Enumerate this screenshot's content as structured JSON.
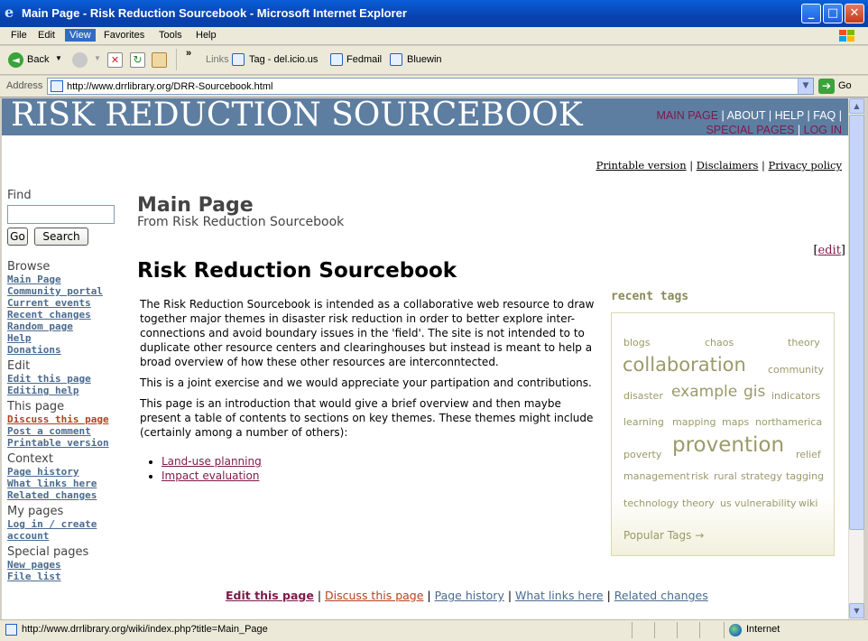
{
  "window": {
    "title": "Main Page - Risk Reduction Sourcebook - Microsoft Internet Explorer"
  },
  "menu": [
    "File",
    "Edit",
    "View",
    "Favorites",
    "Tools",
    "Help"
  ],
  "toolbar": {
    "back_label": "Back",
    "links_label": "Links",
    "chevron": "»",
    "links": [
      "Tag - del.icio.us",
      "Fedmail",
      "Bluewin"
    ]
  },
  "address": {
    "label": "Address",
    "url": "http://www.drrlibrary.org/DRR-Sourcebook.html",
    "go_label": "Go"
  },
  "page": {
    "logo": "RISK REDUCTION SOURCEBOOK",
    "topnav": [
      "MAIN PAGE",
      "ABOUT",
      "HELP",
      "FAQ",
      "SPECIAL PAGES",
      "LOG IN"
    ],
    "tools_links": [
      "Printable version",
      "Disclaimers",
      "Privacy policy"
    ],
    "sidebar": {
      "find_heading": "Find",
      "go_button": "Go",
      "search_button": "Search",
      "browse_heading": "Browse",
      "browse_links": [
        "Main Page",
        "Community portal",
        "Current events",
        "Recent changes",
        "Random page",
        "Help",
        "Donations"
      ],
      "edit_heading": "Edit",
      "edit_links": [
        "Edit this page",
        "Editing help"
      ],
      "thispage_heading": "This page",
      "thispage_links": [
        "Discuss this page",
        "Post a comment",
        "Printable version"
      ],
      "context_heading": "Context",
      "context_links": [
        "Page history",
        "What links here",
        "Related changes"
      ],
      "mypages_heading": "My pages",
      "mypages_links": [
        "Log in / create",
        "account"
      ],
      "special_heading": "Special pages",
      "special_links": [
        "New pages",
        "File list"
      ]
    },
    "title": "Main Page",
    "subtitle": "From Risk Reduction Sourcebook",
    "edit_link": "edit",
    "heading": "Risk Reduction Sourcebook",
    "paragraphs": [
      "The Risk Reduction Sourcebook is intended as a collaborative web resource to draw together major themes in disaster risk reduction in order to better explore inter-connections and avoid boundary issues in the 'field'. The site is not intended to to duplicate other resource centers and clearinghouses but instead is meant to help a broad overview of how these other resources are interconntected.",
      "This is a joint exercise and we would appreciate your partipation and contributions.",
      "This page is an introduction that would give a brief overview and then maybe present a table of contents to sections on key themes. These themes might include (certainly among a number of others):"
    ],
    "list_items": [
      "Land-use planning",
      "Impact evaluation"
    ],
    "recent_tags_heading": "recent tags",
    "tags": [
      "blogs",
      "chaos",
      "theory",
      "collaboration",
      "community",
      "disaster",
      "example",
      "gis",
      "indicators",
      "learning",
      "mapping",
      "maps",
      "northamerica",
      "poverty",
      "provention",
      "relief",
      "management",
      "risk",
      "rural",
      "strategy",
      "tagging",
      "technology",
      "theory",
      "us",
      "vulnerability",
      "wiki"
    ],
    "popular_tags": "Popular Tags →",
    "footer_links": [
      "Edit this page",
      "Discuss this page",
      "Page history",
      "What links here",
      "Related changes"
    ]
  },
  "status": {
    "text": "http://www.drrlibrary.org/wiki/index.php?title=Main_Page",
    "zone": "Internet"
  },
  "colors": {
    "banner": "#5d7ea1",
    "link_maroon": "#7d1a4a",
    "link_blue": "#4a6b8f",
    "link_orange": "#b5411c",
    "tag_olive": "#9a9a6a"
  }
}
